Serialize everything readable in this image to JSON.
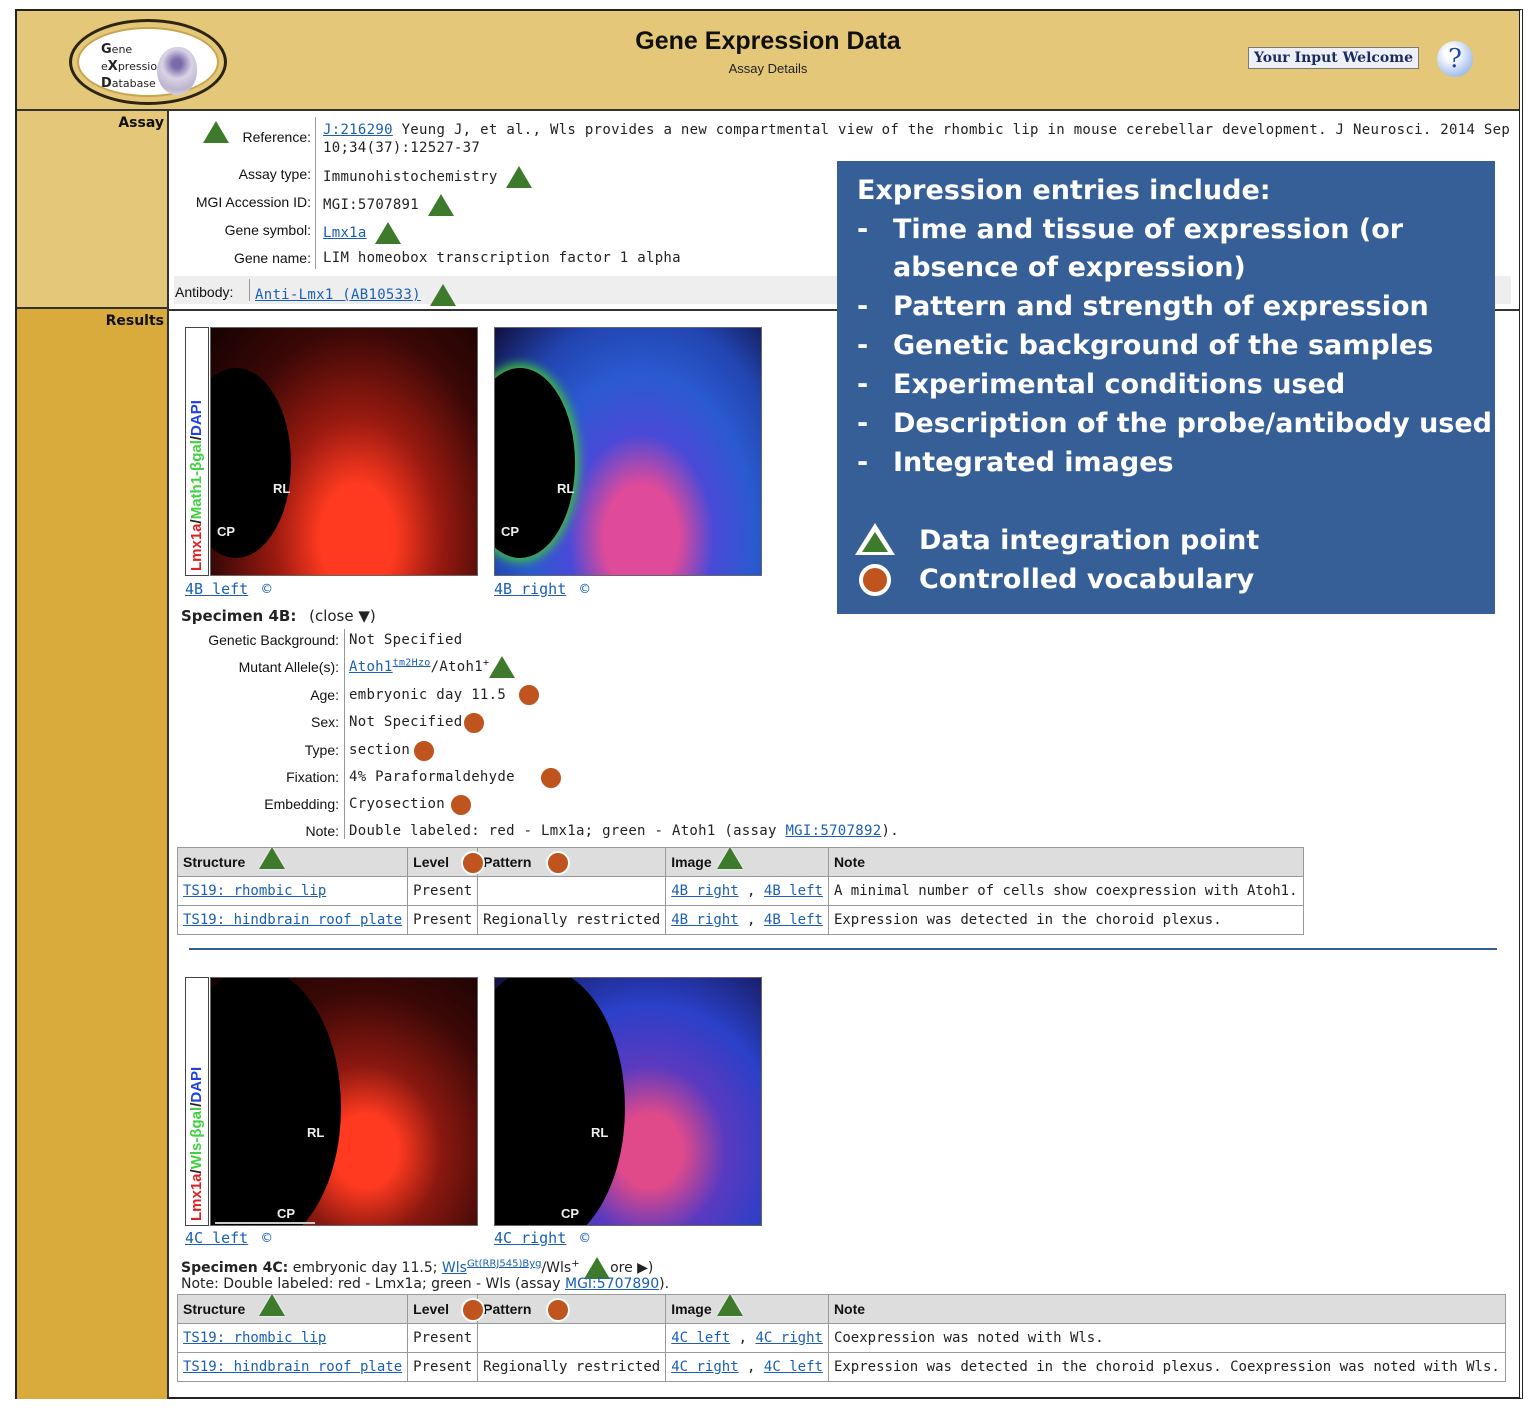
{
  "header": {
    "logo": {
      "line1_bold": "G",
      "line1": "ene",
      "line2_pre": "e",
      "line2_bold": "X",
      "line2": "pression",
      "line3_bold": "D",
      "line3": "atabase"
    },
    "title": "Gene Expression Data",
    "subtitle": "Assay Details",
    "input_button": "Your Input Welcome",
    "help_icon": "?"
  },
  "sections": {
    "assay": "Assay",
    "results": "Results"
  },
  "assay": {
    "reference_label": "Reference:",
    "reference_link": "J:216290",
    "reference_text_line1": "Yeung J, et al., Wls provides a new compartmental view of the rhombic lip in mouse cerebellar development. J Neurosci. 2014 Sep",
    "reference_text_line2": "10;34(37):12527-37",
    "assay_type_label": "Assay type:",
    "assay_type": "Immunohistochemistry",
    "mgi_label": "MGI Accession ID:",
    "mgi_id": "MGI:5707891",
    "gene_symbol_label": "Gene symbol:",
    "gene_symbol": "Lmx1a",
    "gene_name_label": "Gene name:",
    "gene_name": "LIM homeobox transcription factor 1 alpha",
    "antibody_label": "Antibody:",
    "antibody": "Anti-Lmx1 (AB10533)"
  },
  "callout": {
    "heading": "Expression entries include:",
    "items": [
      "Time and tissue of expression (or",
      "absence of expression)",
      "Pattern and strength of expression",
      "Genetic background of the samples",
      "Experimental conditions used",
      "Description of the probe/antibody used",
      "Integrated images"
    ],
    "dash": "-",
    "legend_triangle": "Data integration point",
    "legend_circle": "Controlled vocabulary",
    "colors": {
      "background": "#355f96",
      "triangle": "#3e7a2c",
      "circle": "#c0541e"
    }
  },
  "specimen4b": {
    "legend_strip": {
      "red": "Lmx1a",
      "slash1": "/",
      "green": "Math1-βgal",
      "slash2": "/",
      "blue": "DAPI"
    },
    "image_labels": {
      "rl": "RL",
      "cp": "CP"
    },
    "left_caption": "4B left",
    "right_caption": "4B right",
    "copyright": "©",
    "title": "Specimen 4B:",
    "toggle": "(close ▼)",
    "fields": [
      {
        "label": "Genetic Background:",
        "value": "Not Specified"
      },
      {
        "label": "Mutant Allele(s):",
        "value_link": "Atoh1",
        "sup_link": "tm2Hzo",
        "value_rest": "/Atoh1",
        "sup_rest": "+"
      },
      {
        "label": "Age:",
        "value": "embryonic day 11.5"
      },
      {
        "label": "Sex:",
        "value": "Not Specified"
      },
      {
        "label": "Type:",
        "value": "section"
      },
      {
        "label": "Fixation:",
        "value": "4% Paraformaldehyde"
      },
      {
        "label": "Embedding:",
        "value": "Cryosection"
      },
      {
        "label": "Note:",
        "value": "Double labeled: red - Lmx1a; green - Atoh1 (assay ",
        "link": "MGI:5707892",
        "tail": ")."
      }
    ],
    "table": {
      "headers": [
        "Structure",
        "Level",
        "Pattern",
        "Image",
        "Note"
      ],
      "rows": [
        {
          "structure": "TS19: rhombic lip",
          "level": "Present",
          "pattern": "",
          "img1": "4B right",
          "img2": "4B left",
          "note": "A minimal number of cells show coexpression with Atoh1."
        },
        {
          "structure": "TS19: hindbrain roof plate",
          "level": "Present",
          "pattern": "Regionally restricted",
          "img1": "4B right",
          "img2": "4B left",
          "note": "Expression was detected in the choroid plexus."
        }
      ]
    }
  },
  "specimen4c": {
    "legend_strip": {
      "red": "Lmx1a",
      "slash1": "/",
      "green": "Wls-βgal",
      "slash2": "/",
      "blue": "DAPI"
    },
    "image_labels": {
      "rl": "RL",
      "cp": "CP"
    },
    "left_caption": "4C left",
    "right_caption": "4C right",
    "copyright": "©",
    "title": "Specimen 4C:",
    "summary": "embryonic day 11.5;",
    "allele_link": "Wls",
    "allele_sup": "Gt(RRJ545)Byg",
    "allele_rest": "/Wls",
    "allele_rest_sup": "+",
    "more": "ore ▶)",
    "note_prefix": "Note: Double labeled: red - Lmx1a; green - Wls (assay ",
    "note_link": "MGI:5707890",
    "note_tail": ").",
    "table": {
      "headers": [
        "Structure",
        "Level",
        "Pattern",
        "Image",
        "Note"
      ],
      "rows": [
        {
          "structure": "TS19: rhombic lip",
          "level": "Present",
          "pattern": "",
          "img1": "4C left",
          "img2": "4C right",
          "note": "Coexpression was noted with Wls."
        },
        {
          "structure": "TS19: hindbrain roof plate",
          "level": "Present",
          "pattern": "Regionally restricted",
          "img1": "4C right",
          "img2": "4C left",
          "note": "Expression was detected in the choroid plexus. Coexpression was noted with Wls."
        }
      ]
    }
  },
  "colors": {
    "header_bg": "#e4c778",
    "results_bg": "#d8ab3c",
    "link": "#1a5fb4"
  }
}
